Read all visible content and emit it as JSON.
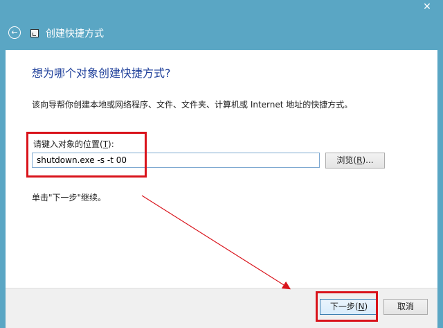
{
  "window": {
    "title": "创建快捷方式",
    "close_glyph": "✕",
    "back_glyph": "←"
  },
  "page": {
    "heading": "想为哪个对象创建快捷方式?",
    "description": "该向导帮你创建本地或网络程序、文件、文件夹、计算机或 Internet 地址的快捷方式。",
    "field_label_prefix": "请键入对象的位置(",
    "field_label_key": "T",
    "field_label_suffix": "):",
    "location_value": "shutdown.exe -s -t 00",
    "browse_prefix": "浏览(",
    "browse_key": "R",
    "browse_suffix": ")...",
    "hint": "单击\"下一步\"继续。"
  },
  "footer": {
    "next_prefix": "下一步(",
    "next_key": "N",
    "next_suffix": ")",
    "cancel_label": "取消"
  },
  "annotations": {
    "highlight_color": "#d9131b"
  }
}
